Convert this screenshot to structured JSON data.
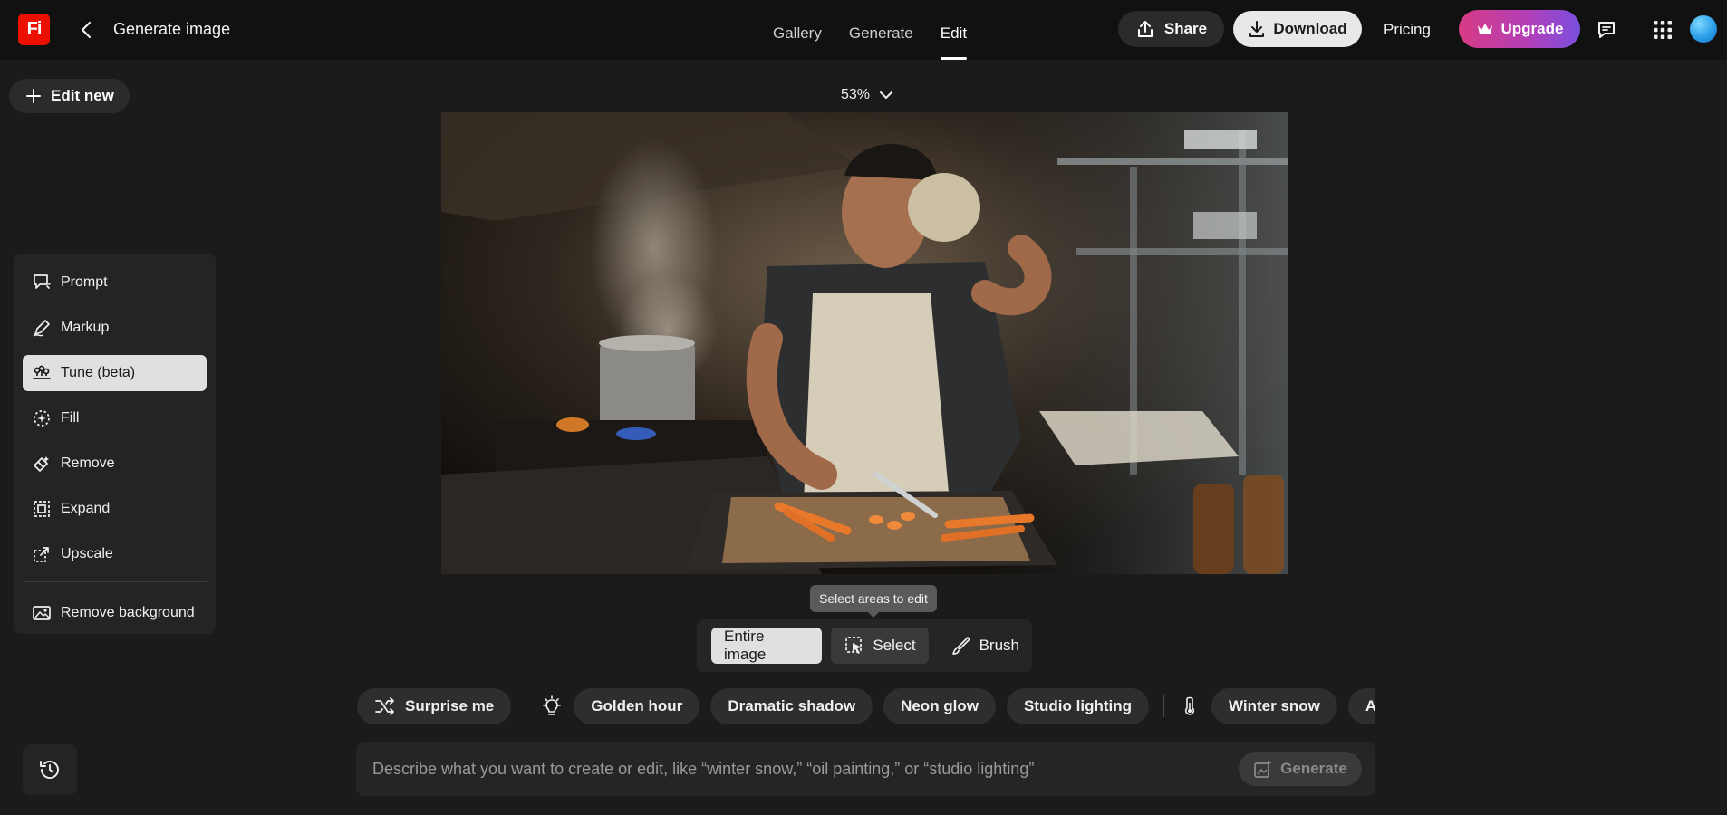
{
  "app": {
    "logo_text": "Fi",
    "page_title": "Generate image"
  },
  "nav": {
    "tabs": [
      {
        "label": "Gallery",
        "active": false
      },
      {
        "label": "Generate",
        "active": false
      },
      {
        "label": "Edit",
        "active": true
      }
    ]
  },
  "header_actions": {
    "share_label": "Share",
    "download_label": "Download",
    "pricing_label": "Pricing",
    "upgrade_label": "Upgrade"
  },
  "edit_new_label": "Edit new",
  "zoom": {
    "value": "53%"
  },
  "tools": [
    {
      "label": "Prompt",
      "icon": "prompt-icon",
      "active": false
    },
    {
      "label": "Markup",
      "icon": "markup-icon",
      "active": false
    },
    {
      "label": "Tune (beta)",
      "icon": "tune-icon",
      "active": true
    },
    {
      "label": "Fill",
      "icon": "fill-icon",
      "active": false
    },
    {
      "label": "Remove",
      "icon": "remove-icon",
      "active": false
    },
    {
      "label": "Expand",
      "icon": "expand-icon",
      "active": false
    },
    {
      "label": "Upscale",
      "icon": "upscale-icon",
      "active": false
    },
    {
      "label": "Remove background",
      "icon": "remove-background-icon",
      "active": false
    }
  ],
  "selection": {
    "tooltip": "Select areas to edit",
    "entire_image_label": "Entire image",
    "select_label": "Select",
    "brush_label": "Brush"
  },
  "chips": {
    "surprise_label": "Surprise me",
    "lighting": [
      "Golden hour",
      "Dramatic shadow",
      "Neon glow",
      "Studio lighting"
    ],
    "weather": [
      "Winter snow",
      "Autumn"
    ]
  },
  "prompt": {
    "placeholder": "Describe what you want to create or edit, like “winter snow,” “oil painting,” or “studio lighting”",
    "generate_label": "Generate"
  },
  "colors": {
    "background": "#1b1b1b",
    "topbar": "#111111",
    "logo": "#eb1000",
    "upgrade_gradient_start": "#d73b84",
    "upgrade_gradient_end": "#7a4fe0"
  }
}
